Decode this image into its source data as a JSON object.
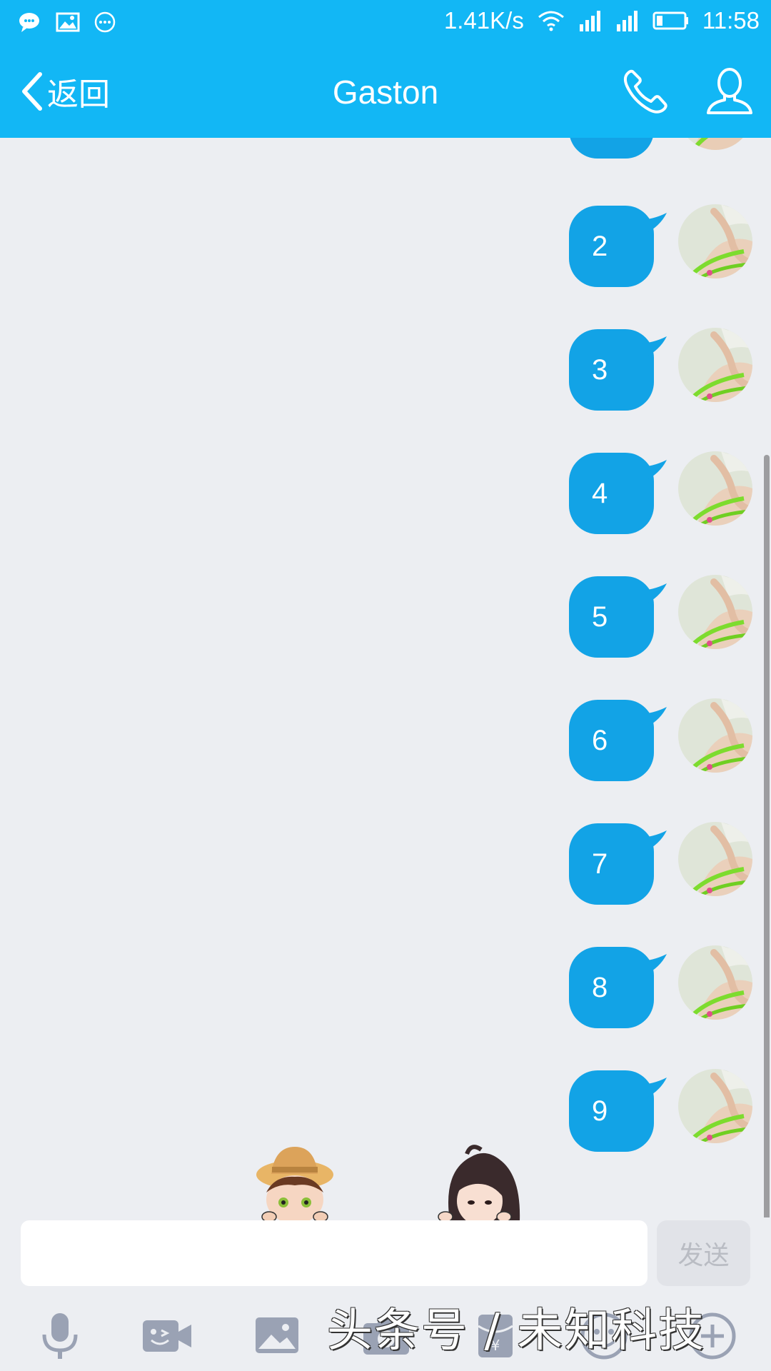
{
  "status_bar": {
    "net_speed": "1.41K/s",
    "time": "11:58",
    "left_icons": [
      "message-icon",
      "image-icon",
      "more-icon"
    ],
    "right_icons": [
      "wifi-icon",
      "signal-icon",
      "signal-icon",
      "battery-icon"
    ]
  },
  "nav": {
    "back_label": "返回",
    "title": "Gaston",
    "call_icon": "phone-icon",
    "profile_icon": "person-icon"
  },
  "messages": [
    {
      "text": "2"
    },
    {
      "text": "3"
    },
    {
      "text": "4"
    },
    {
      "text": "5"
    },
    {
      "text": "6"
    },
    {
      "text": "7"
    },
    {
      "text": "8"
    },
    {
      "text": "9"
    }
  ],
  "input": {
    "value": "",
    "placeholder": "",
    "send_label": "发送"
  },
  "toolbar": {
    "icons": [
      "microphone-icon",
      "video-icon",
      "image-icon",
      "camera-icon",
      "red-packet-icon",
      "emoji-icon",
      "plus-icon"
    ]
  },
  "watermark": "头条号 / 未知科技",
  "colors": {
    "accent": "#12b7f5",
    "bubble": "#12a3e6",
    "background": "#eceef2"
  }
}
